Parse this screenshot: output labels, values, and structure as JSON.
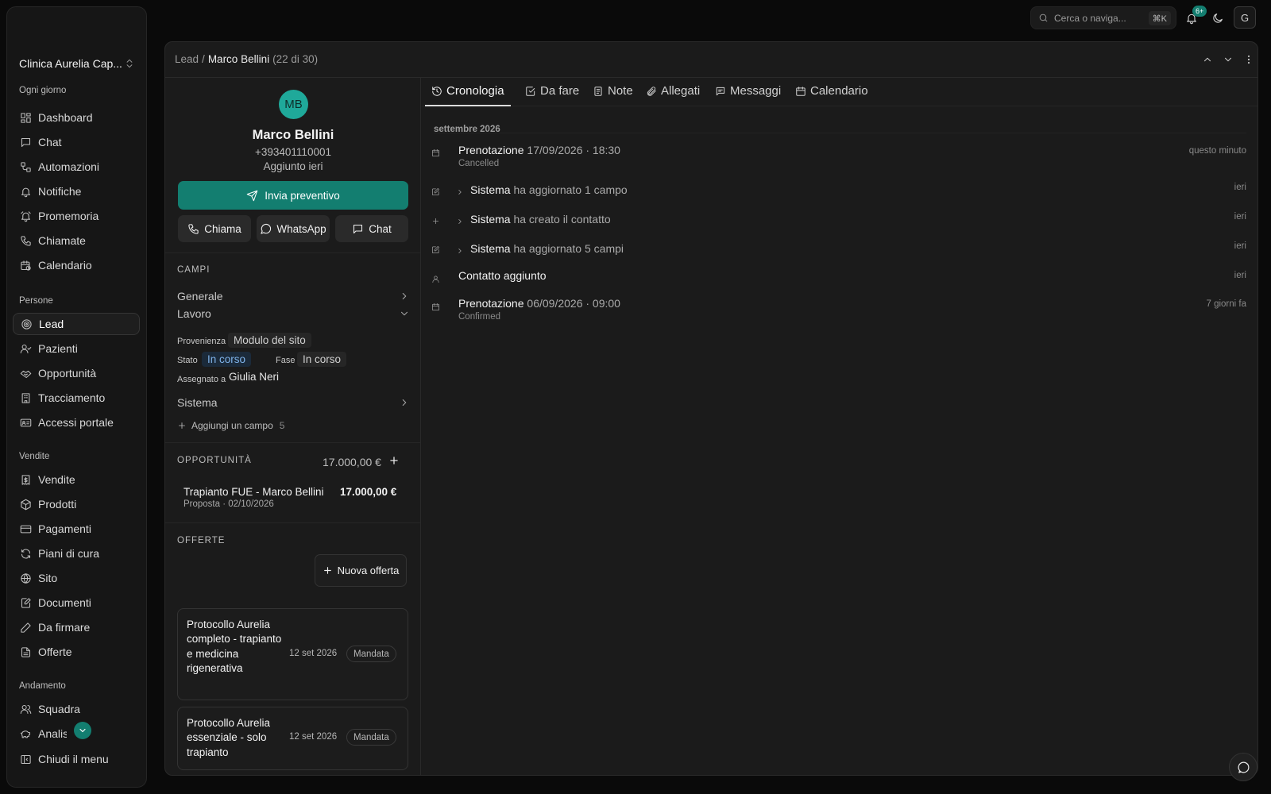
{
  "sidebar": {
    "org_name": "Clinica Aurelia Cap...",
    "sections": [
      {
        "title": "Ogni giorno"
      },
      {
        "title": "Persone"
      },
      {
        "title": "Vendite"
      },
      {
        "title": "Andamento"
      }
    ],
    "items": [
      {
        "label": "Dashboard",
        "icon": "dashboard-icon"
      },
      {
        "label": "Chat",
        "icon": "chat-icon"
      },
      {
        "label": "Automazioni",
        "icon": "automation-icon"
      },
      {
        "label": "Notifiche",
        "icon": "bell-icon"
      },
      {
        "label": "Promemoria",
        "icon": "reminder-bell-icon"
      },
      {
        "label": "Chiamate",
        "icon": "phone-icon"
      },
      {
        "label": "Calendario",
        "icon": "calendar-clock-icon"
      },
      {
        "label": "Lead",
        "icon": "target-icon",
        "active": true
      },
      {
        "label": "Pazienti",
        "icon": "user-check-icon"
      },
      {
        "label": "Opportunità",
        "icon": "handshake-icon"
      },
      {
        "label": "Tracciamento",
        "icon": "building-icon"
      },
      {
        "label": "Accessi portale",
        "icon": "id-card-icon"
      },
      {
        "label": "Vendite",
        "icon": "receipt-icon"
      },
      {
        "label": "Prodotti",
        "icon": "box-icon"
      },
      {
        "label": "Pagamenti",
        "icon": "credit-card-icon"
      },
      {
        "label": "Piani di cura",
        "icon": "refresh-icon"
      },
      {
        "label": "Sito",
        "icon": "globe-icon"
      },
      {
        "label": "Documenti",
        "icon": "document-edit-icon"
      },
      {
        "label": "Da firmare",
        "icon": "pen-icon"
      },
      {
        "label": "Offerte",
        "icon": "file-text-icon"
      },
      {
        "label": "Squadra",
        "icon": "users-icon"
      },
      {
        "label": "Analisi",
        "icon": "piggy-bank-icon"
      }
    ],
    "collapse_label": "Chiudi il menu"
  },
  "topbar": {
    "search_placeholder": "Cerca o naviga...",
    "shortcut": "⌘K",
    "notifications_badge": "6+",
    "user_initial": "G"
  },
  "breadcrumb": {
    "root": "Lead",
    "separator": "/",
    "current": "Marco Bellini",
    "position": "(22 di 30)"
  },
  "lead": {
    "initials": "MB",
    "name": "Marco Bellini",
    "phone": "+393401110001",
    "added": "Aggiunto ieri",
    "primary_action": "Invia preventivo",
    "actions": [
      "Chiama",
      "WhatsApp",
      "Chat"
    ],
    "accent_color": "#137e70",
    "avatar_color": "#1fa99a"
  },
  "fields": {
    "section_title": "CAMPI",
    "groups": [
      "Generale",
      "Lavoro",
      "Sistema"
    ],
    "provenienza_label": "Provenienza",
    "provenienza": "Modulo del sito",
    "stato_label": "Stato",
    "stato": "In corso",
    "fase_label": "Fase",
    "fase": "In corso",
    "assegnato_label": "Assegnato a",
    "assegnato": "Giulia Neri",
    "add_field": "Aggiungi un campo",
    "add_field_count": "5"
  },
  "opportunities": {
    "section_title": "OPPORTUNITÀ",
    "total": "17.000,00 €",
    "items": [
      {
        "title": "Trapianto FUE - Marco Bellini",
        "amount": "17.000,00 €",
        "meta": "Proposta · 02/10/2026"
      }
    ]
  },
  "offers": {
    "section_title": "OFFERTE",
    "new_button": "Nuova offerta",
    "items": [
      {
        "title": "Protocollo Aurelia completo - trapianto e medicina rigenerativa",
        "date": "12 set 2026",
        "status": "Mandata"
      },
      {
        "title": "Protocollo Aurelia essenziale - solo trapianto",
        "date": "12 set 2026",
        "status": "Mandata"
      }
    ]
  },
  "tabs": [
    {
      "label": "Cronologia",
      "icon": "history-icon",
      "active": true
    },
    {
      "label": "Da fare",
      "icon": "checkbox-icon"
    },
    {
      "label": "Note",
      "icon": "note-icon"
    },
    {
      "label": "Allegati",
      "icon": "paperclip-icon"
    },
    {
      "label": "Messaggi",
      "icon": "message-icon"
    },
    {
      "label": "Calendario",
      "icon": "calendar-icon"
    }
  ],
  "timeline": {
    "month": "settembre 2026",
    "events": [
      {
        "title": "Prenotazione",
        "detail": "17/09/2026 · 18:30",
        "sub": "Cancelled",
        "time": "questo minuto",
        "icon": "calendar-icon"
      },
      {
        "title": "Sistema",
        "detail": "ha aggiornato 1 campo",
        "time": "ieri",
        "icon": "edit-icon"
      },
      {
        "title": "Sistema",
        "detail": "ha creato il contatto",
        "time": "ieri",
        "icon": "plus-icon"
      },
      {
        "title": "Sistema",
        "detail": "ha aggiornato 5 campi",
        "time": "ieri",
        "icon": "edit-icon"
      },
      {
        "title": "Contatto aggiunto",
        "detail": "",
        "time": "ieri",
        "icon": "user-icon"
      },
      {
        "title": "Prenotazione",
        "detail": "06/09/2026 · 09:00",
        "sub": "Confirmed",
        "time": "7 giorni fa",
        "icon": "calendar-icon"
      }
    ]
  }
}
